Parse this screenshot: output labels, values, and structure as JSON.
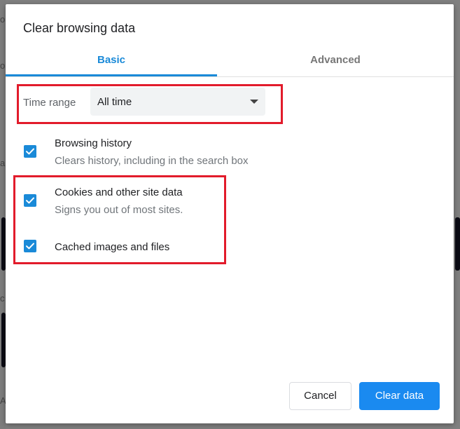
{
  "dialog": {
    "title": "Clear browsing data"
  },
  "tabs": [
    {
      "label": "Basic",
      "active": true
    },
    {
      "label": "Advanced",
      "active": false
    }
  ],
  "time_range": {
    "label": "Time range",
    "selected": "All time"
  },
  "items": [
    {
      "title": "Browsing history",
      "description": "Clears history, including in the search box",
      "checked": true
    },
    {
      "title": "Cookies and other site data",
      "description": "Signs you out of most sites.",
      "checked": true
    },
    {
      "title": "Cached images and files",
      "description": "",
      "checked": true
    }
  ],
  "buttons": {
    "cancel": "Cancel",
    "clear": "Clear data"
  },
  "colors": {
    "accent": "#1a8ad8",
    "highlight": "#e21b2b",
    "primary_button": "#1a8af0"
  },
  "background_fragments": [
    "o",
    "o",
    "a",
    "c",
    "A"
  ]
}
